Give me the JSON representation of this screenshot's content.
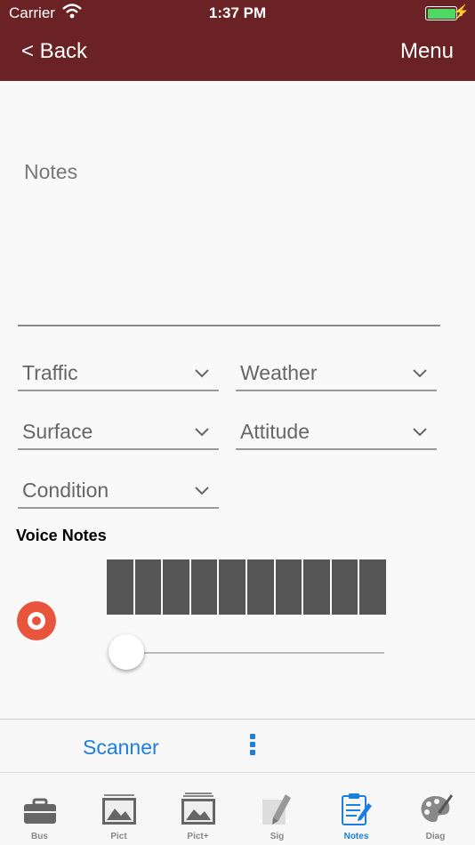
{
  "status_bar": {
    "carrier": "Carrier",
    "time": "1:37 PM",
    "battery_color": "#4cd964"
  },
  "nav": {
    "back_label": "< Back",
    "menu_label": "Menu",
    "bar_color": "#6b2224"
  },
  "form": {
    "notes_placeholder": "Notes",
    "dropdowns": [
      {
        "label": "Traffic"
      },
      {
        "label": "Weather"
      },
      {
        "label": "Surface"
      },
      {
        "label": "Attitude"
      },
      {
        "label": "Condition"
      }
    ]
  },
  "voice": {
    "title": "Voice Notes",
    "wave_bar_count": 10,
    "playback_position": 0,
    "record_color": "#e8553c"
  },
  "toolbar": {
    "scanner_label": "Scanner",
    "more_icon": "more-vertical-icon",
    "accent": "#1a7fe0"
  },
  "tabs": [
    {
      "label": "Bus",
      "icon": "briefcase-icon",
      "active": false
    },
    {
      "label": "Pict",
      "icon": "picture-icon",
      "active": false
    },
    {
      "label": "Pict+",
      "icon": "pictures-stack-icon",
      "active": false
    },
    {
      "label": "Sig",
      "icon": "signature-pen-icon",
      "active": false
    },
    {
      "label": "Notes",
      "icon": "clipboard-notes-icon",
      "active": true
    },
    {
      "label": "Diag",
      "icon": "palette-icon",
      "active": false
    }
  ]
}
